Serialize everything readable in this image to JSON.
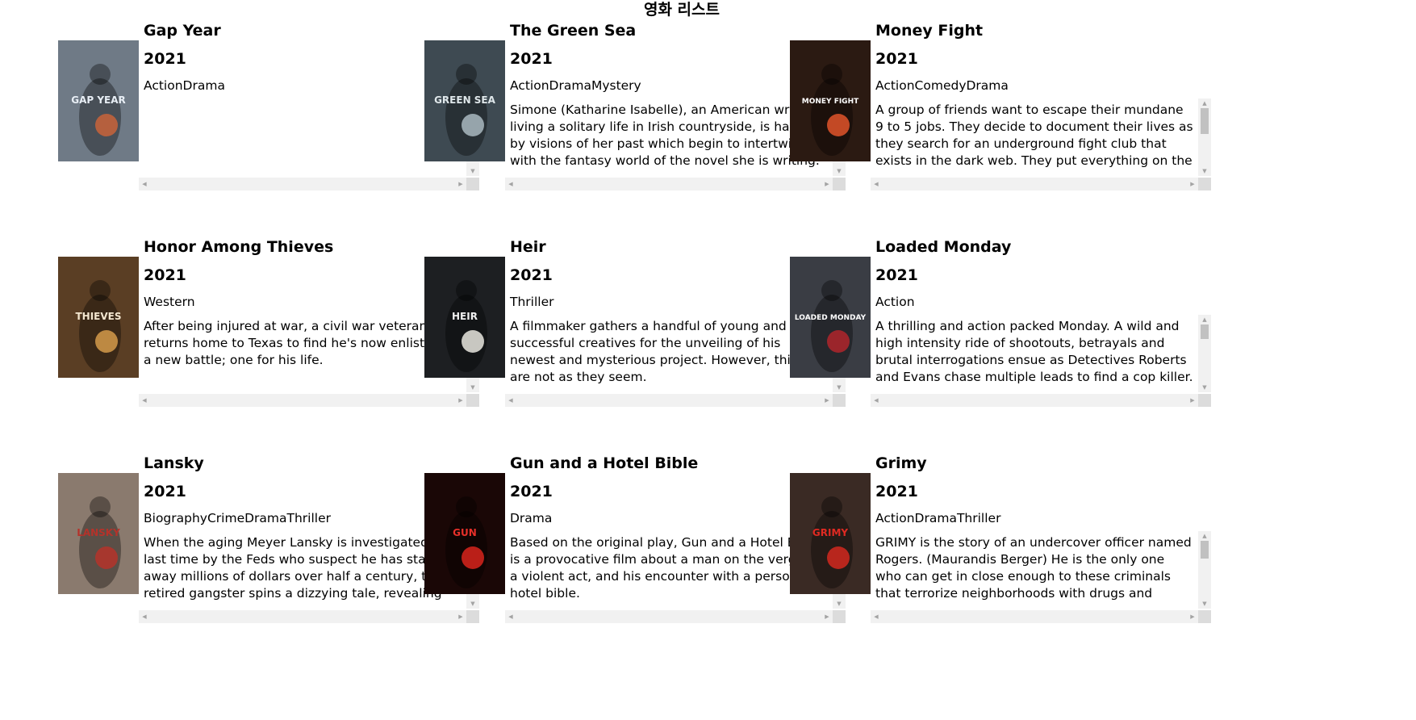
{
  "page": {
    "title": "영화 리스트"
  },
  "movies": [
    {
      "title": "Gap Year",
      "year": "2021",
      "genres": "ActionDrama",
      "plot": "",
      "poster": {
        "bg": "#6f7a86",
        "accent": "#c9633a",
        "text": "GAP YEAR",
        "text_color": "#e8eef5"
      }
    },
    {
      "title": "The Green Sea",
      "year": "2021",
      "genres": "ActionDramaMystery",
      "plot": "Simone (Katharine Isabelle), an American writer living a solitary life in Irish countryside, is haunted by visions of her past which begin to intertwine with the fantasy world of the novel she is writing.",
      "poster": {
        "bg": "#3e4a52",
        "accent": "#a9b8c0",
        "text": "GREEN SEA",
        "text_color": "#dfe7ea"
      }
    },
    {
      "title": "Money Fight",
      "year": "2021",
      "genres": "ActionComedyDrama",
      "plot": "A group of friends want to escape their mundane 9 to 5 jobs. They decide to document their lives as they search for an underground fight club that exists in the dark web. They put everything on the line.",
      "poster": {
        "bg": "#2b1a12",
        "accent": "#e0542a",
        "text": "MONEY FIGHT",
        "text_color": "#ffffff"
      }
    },
    {
      "title": "Honor Among Thieves",
      "year": "2021",
      "genres": "Western",
      "plot": "After being injured at war, a civil war veteran returns home to Texas to find he's now enlisted in a new battle; one for his life.",
      "poster": {
        "bg": "#5a3e24",
        "accent": "#d59a4a",
        "text": "THIEVES",
        "text_color": "#f3e6cf"
      }
    },
    {
      "title": "Heir",
      "year": "2021",
      "genres": "Thriller",
      "plot": "A filmmaker gathers a handful of young and successful creatives for the unveiling of his newest and mysterious project. However, things are not as they seem.",
      "poster": {
        "bg": "#1d1f22",
        "accent": "#e9e6df",
        "text": "HEIR",
        "text_color": "#f0f0f0"
      }
    },
    {
      "title": "Loaded Monday",
      "year": "2021",
      "genres": "Action",
      "plot": "A thrilling and action packed Monday. A wild and high intensity ride of shootouts, betrayals and brutal interrogations ensue as Detectives Roberts and Evans chase multiple leads to find a cop killer.",
      "poster": {
        "bg": "#3a3d44",
        "accent": "#b0262b",
        "text": "LOADED MONDAY",
        "text_color": "#ffffff"
      }
    },
    {
      "title": "Lansky",
      "year": "2021",
      "genres": "BiographyCrimeDramaThriller",
      "plot": "When the aging Meyer Lansky is investigated one last time by the Feds who suspect he has stashed away millions of dollars over half a century, the retired gangster spins a dizzying tale, revealing the secrets of his life.",
      "poster": {
        "bg": "#8a7a6e",
        "accent": "#b5322a",
        "text": "LANSKY",
        "text_color": "#b5322a"
      }
    },
    {
      "title": "Gun and a Hotel Bible",
      "year": "2021",
      "genres": "Drama",
      "plot": "Based on the original play, Gun and a Hotel Bible is a provocative film about a man on the verge of a violent act, and his encounter with a personified hotel bible.",
      "poster": {
        "bg": "#1a0706",
        "accent": "#d8251c",
        "text": "GUN",
        "text_color": "#e8302a"
      }
    },
    {
      "title": "Grimy",
      "year": "2021",
      "genres": "ActionDramaThriller",
      "plot": "GRIMY is the story of an undercover officer named Rogers. (Maurandis Berger) He is the only one who can get in close enough to these criminals that terrorize neighborhoods with drugs and violence.",
      "poster": {
        "bg": "#3a2a24",
        "accent": "#d2281f",
        "text": "GRIMY",
        "text_color": "#e02a22"
      }
    }
  ]
}
